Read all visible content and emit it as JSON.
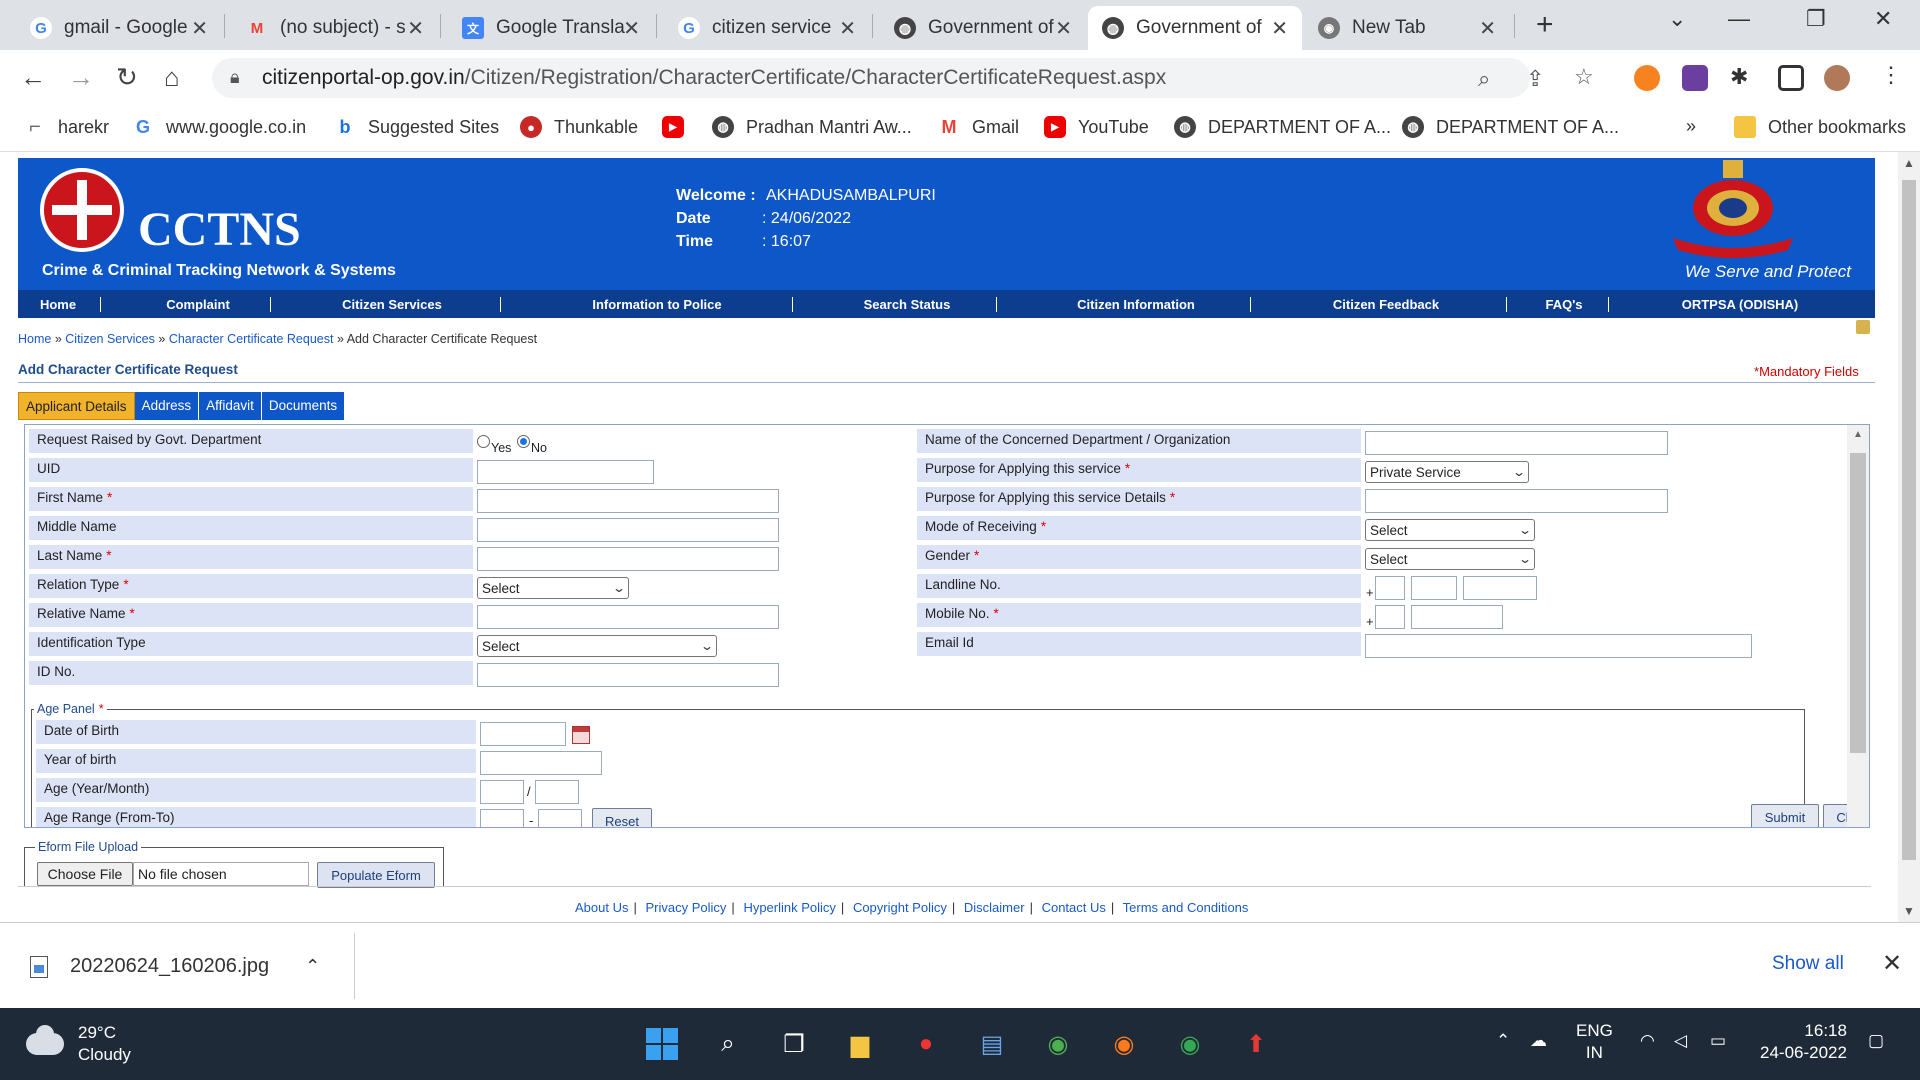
{
  "browser": {
    "tabs": [
      {
        "title": "gmail - Google",
        "icon": "google-icon",
        "color": "#4285f4"
      },
      {
        "title": "(no subject) - s",
        "icon": "gmail-icon",
        "color": "#ea4335"
      },
      {
        "title": "Google Transla",
        "icon": "translate-icon",
        "color": "#4285f4"
      },
      {
        "title": "citizen service",
        "icon": "google-icon",
        "color": "#4285f4"
      },
      {
        "title": "Government of",
        "icon": "globe-icon",
        "color": "#444444"
      },
      {
        "title": "Government of",
        "icon": "globe-icon",
        "color": "#444444",
        "active": true
      },
      {
        "title": "New Tab",
        "icon": "chrome-icon",
        "color": "#777777"
      }
    ],
    "url_host": "citizenportal-op.gov.in",
    "url_path": "/Citizen/Registration/CharacterCertificate/CharacterCertificateRequest.aspx",
    "bookmarks": [
      {
        "label": "harekr",
        "icon": "profile-icon"
      },
      {
        "label": "www.google.co.in",
        "icon": "google-icon"
      },
      {
        "label": "Suggested Sites",
        "icon": "bing-icon"
      },
      {
        "label": "Thunkable",
        "icon": "thunkable-icon"
      },
      {
        "label": "",
        "icon": "youtube-icon"
      },
      {
        "label": "Pradhan Mantri Aw...",
        "icon": "globe-icon"
      },
      {
        "label": "Gmail",
        "icon": "gmail-icon"
      },
      {
        "label": "YouTube",
        "icon": "youtube-icon"
      },
      {
        "label": "DEPARTMENT OF A...",
        "icon": "globe-icon"
      },
      {
        "label": "DEPARTMENT OF A...",
        "icon": "globe-icon"
      }
    ],
    "bookmarks_more": "»",
    "other_bookmarks": "Other bookmarks"
  },
  "site": {
    "logo_title": "CCTNS",
    "logo_subtitle": "Crime & Criminal Tracking Network & Systems",
    "welcome_label": "Welcome :",
    "welcome_value": "AKHADUSAMBALPURI",
    "date_label": "Date",
    "date_value": ": 24/06/2022",
    "time_label": "Time",
    "time_value": ": 16:07",
    "motto": "We Serve and Protect",
    "nav": [
      "Home",
      "Complaint",
      "Citizen Services",
      "Information to Police",
      "Search Status",
      "Citizen Information",
      "Citizen Feedback",
      "FAQ's",
      "ORTPSA (ODISHA)"
    ]
  },
  "breadcrumb": {
    "home": "Home",
    "sep": "»",
    "citizen_services": "Citizen Services",
    "request": "Character Certificate Request",
    "current": "Add Character Certificate Request"
  },
  "page": {
    "title": "Add Character Certificate Request",
    "mandatory_star": "*",
    "mandatory_text": "Mandatory Fields",
    "tabs": [
      "Applicant Details",
      "Address",
      "Affidavit",
      "Documents"
    ]
  },
  "form": {
    "left": {
      "govt_dept": "Request Raised by Govt. Department",
      "yes": "Yes",
      "no": "No",
      "uid": "UID",
      "first_name": "First Name",
      "middle_name": "Middle Name",
      "last_name": "Last Name",
      "relation_type": "Relation Type",
      "relation_type_value": "Select",
      "relative_name": "Relative Name",
      "identification_type": "Identification Type",
      "identification_type_value": "Select",
      "id_no": "ID No."
    },
    "right": {
      "dept_name": "Name of the Concerned Department / Organization",
      "purpose": "Purpose for Applying this service",
      "purpose_value": "Private Service",
      "purpose_details": "Purpose for Applying this service Details",
      "mode_receiving": "Mode of Receiving",
      "mode_receiving_value": "Select",
      "gender": "Gender",
      "gender_value": "Select",
      "landline": "Landline No.",
      "mobile": "Mobile No.",
      "email": "Email Id",
      "plus": "+"
    },
    "required_mark": "*",
    "age_panel": {
      "legend": "Age Panel",
      "dob": "Date of Birth",
      "yob": "Year of birth",
      "age": "Age (Year/Month)",
      "age_sep": "/",
      "range": "Age Range (From-To)",
      "range_sep": "-",
      "reset": "Reset"
    },
    "submit": "Submit",
    "close": "Close",
    "eform": {
      "legend": "Eform File Upload",
      "choose": "Choose File",
      "no_file": "No file chosen",
      "populate": "Populate Eform"
    }
  },
  "footer": [
    "About Us",
    "Privacy Policy",
    "Hyperlink Policy",
    "Copyright Policy",
    "Disclaimer",
    "Contact Us",
    "Terms and Conditions"
  ],
  "footer_sep": "|",
  "download": {
    "filename": "20220624_160206.jpg",
    "show_all": "Show all"
  },
  "taskbar": {
    "temp": "29°C",
    "weather": "Cloudy",
    "lang1": "ENG",
    "lang2": "IN",
    "time": "16:18",
    "date": "24-06-2022"
  }
}
